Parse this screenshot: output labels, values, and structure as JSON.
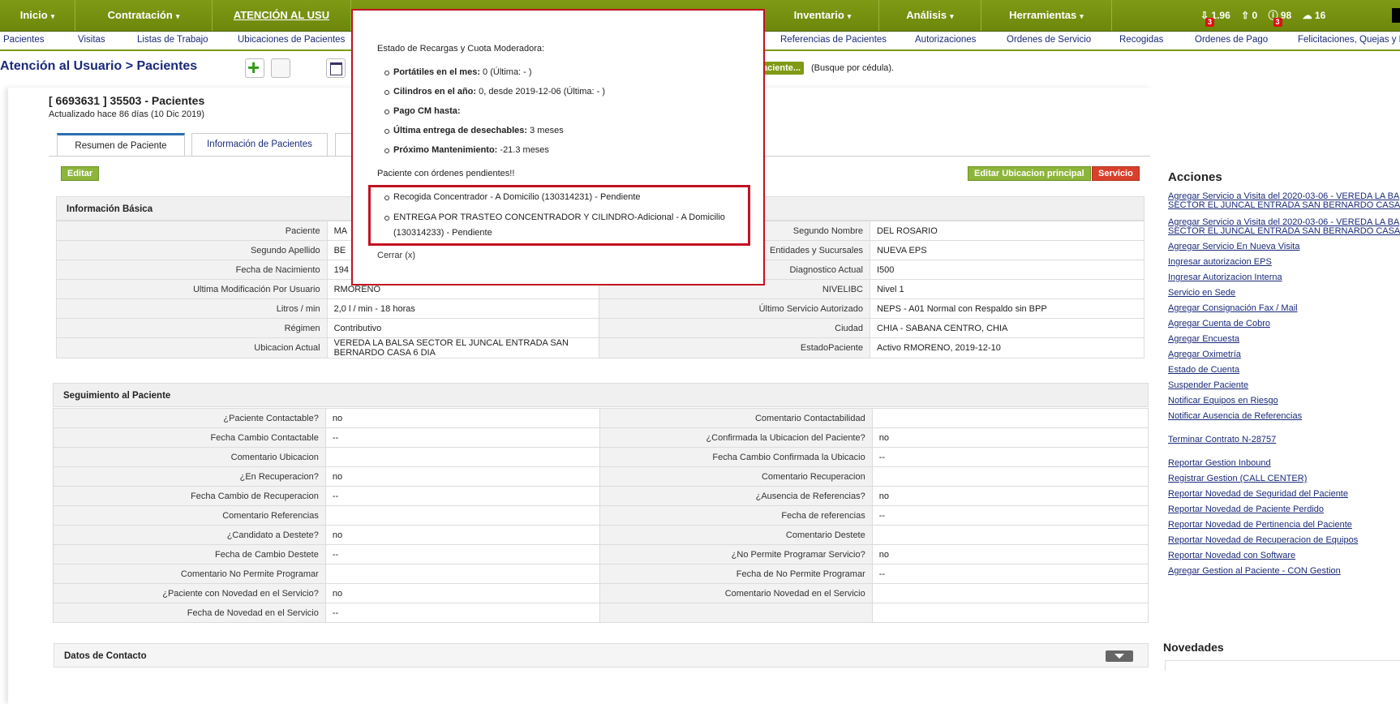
{
  "topnav": {
    "items": [
      {
        "label": "Inicio",
        "caret": "▾"
      },
      {
        "label": "Contratación",
        "caret": "▾"
      },
      {
        "label": "ATENCIÓN AL USU",
        "caret": ""
      },
      {
        "label": "Inventario",
        "caret": "▾"
      },
      {
        "label": "Análisis",
        "caret": "▾"
      },
      {
        "label": "Herramientas",
        "caret": "▾"
      }
    ],
    "badges": [
      {
        "icon": "download-icon",
        "count": "1.96",
        "alert": "3"
      },
      {
        "icon": "upload-icon",
        "count": "0",
        "alert": ""
      },
      {
        "icon": "alert-icon",
        "count": "98",
        "alert": "3"
      },
      {
        "icon": "chat-icon",
        "count": "16",
        "alert": ""
      }
    ]
  },
  "subnav": [
    "Pacientes",
    "Visitas",
    "Listas de Trabajo",
    "Ubicaciones de Pacientes",
    "Referencias de Pacientes",
    "Autorizaciones",
    "Ordenes de Servicio",
    "Recogidas",
    "Ordenes de Pago",
    "Felicitaciones, Quejas y R"
  ],
  "breadcrumb": {
    "section": "Atención al Usuario",
    "sep": " > ",
    "page": "Pacientes"
  },
  "search": {
    "button": "aciente...",
    "hint": "(Busque por cédula)."
  },
  "patient": {
    "title": "[ 6693631 ] 35503 - Pacientes",
    "updated": "Actualizado hace 86 días (10 Dic 2019)"
  },
  "tabs": [
    "Resumen de Paciente",
    "Información de Pacientes",
    ""
  ],
  "buttons": {
    "edit": "Editar",
    "edit_location": "Editar Ubicacion principal",
    "service": "Servicio"
  },
  "basic": {
    "header": "Información Básica",
    "rows": [
      [
        "Paciente",
        "MA",
        "Segundo Nombre",
        "DEL ROSARIO"
      ],
      [
        "Segundo Apellido",
        "BE",
        "Entidades y Sucursales",
        "NUEVA EPS"
      ],
      [
        "Fecha de Nacimiento",
        "194",
        "Diagnostico Actual",
        "I500"
      ],
      [
        "Ultima Modificación Por Usuario",
        "RMORENO",
        "NIVELIBC",
        "Nivel 1"
      ],
      [
        "Litros / min",
        "2,0 l / min - 18 horas",
        "Último Servicio Autorizado",
        "NEPS - A01 Normal con Respaldo sin BPP"
      ],
      [
        "Régimen",
        "Contributivo",
        "Ciudad",
        "CHIA - SABANA CENTRO, CHIA"
      ],
      [
        "Ubicacion Actual",
        "VEREDA LA BALSA SECTOR EL JUNCAL ENTRADA SAN BERNARDO CASA 6 DIA",
        "EstadoPaciente",
        "Activo RMORENO, 2019-12-10"
      ]
    ]
  },
  "seguimiento": {
    "header": "Seguimiento al Paciente",
    "rows": [
      [
        "¿Paciente Contactable?",
        "no",
        "Comentario Contactabilidad",
        ""
      ],
      [
        "Fecha Cambio Contactable",
        "--",
        "¿Confirmada la Ubicacion del Paciente?",
        "no"
      ],
      [
        "Comentario Ubicacion",
        "",
        "Fecha Cambio Confirmada la Ubicacio",
        "--"
      ],
      [
        "¿En Recuperacion?",
        "no",
        "Comentario Recuperacion",
        ""
      ],
      [
        "Fecha Cambio de Recuperacion",
        "--",
        "¿Ausencia de Referencias?",
        "no"
      ],
      [
        "Comentario Referencias",
        "",
        "Fecha de referencias",
        "--"
      ],
      [
        "¿Candidato a Destete?",
        "no",
        "Comentario Destete",
        ""
      ],
      [
        "Fecha de Cambio Destete",
        "--",
        "¿No Permite Programar Servicio?",
        "no"
      ],
      [
        "Comentario No Permite Programar",
        "",
        "Fecha de No Permite Programar",
        "--"
      ],
      [
        "¿Paciente con Novedad en el Servicio?",
        "no",
        "Comentario Novedad en el Servicio",
        ""
      ],
      [
        "Fecha de Novedad en el Servicio",
        "--",
        "",
        ""
      ]
    ]
  },
  "contacto": {
    "header": "Datos de Contacto"
  },
  "acciones": {
    "title": "Acciones",
    "links": [
      "Agregar Servicio a Visita del 2020-03-06 - VEREDA LA BA",
      "SECTOR EL JUNCAL ENTRADA SAN BERNARDO CASA",
      "Agregar Servicio a Visita del 2020-03-06 - VEREDA LA BA",
      "SECTOR EL JUNCAL ENTRADA SAN BERNARDO CASA",
      "Agregar Servicio En Nueva Visita",
      "Ingresar autorizacion EPS",
      "Ingresar Autorizacion Interna",
      "Servicio en Sede",
      "Agregar Consignación Fax / Mail",
      "Agregar Cuenta de Cobro",
      "Agregar Encuesta",
      "Agregar Oximetría",
      "Estado de Cuenta",
      "Suspender Paciente",
      "Notificar Equipos en Riesgo",
      "Notificar Ausencia de Referencias",
      "Terminar Contrato N-28757",
      "Reportar Gestion Inbound",
      "Registrar Gestion (CALL CENTER)",
      "Reportar Novedad de Seguridad del Paciente",
      "Reportar Novedad de Paciente Perdido",
      "Reportar Novedad de Pertinencia del Paciente",
      "Reportar Novedad de Recuperacion de Equipos",
      "Reportar Novedad con Software",
      "Agregar Gestion al Paciente - CON Gestion"
    ],
    "novedades": "Novedades"
  },
  "modal": {
    "title": "Estado de Recargas y Cuota Moderadora:",
    "items": [
      {
        "label": "Portátiles en el mes:",
        "value": " 0 (Última: - )"
      },
      {
        "label": "Cilindros en el año:",
        "value": " 0, desde 2019-12-06 (Última: - )"
      },
      {
        "label": "Pago CM hasta:",
        "value": ""
      },
      {
        "label": "Última entrega de desechables:",
        "value": " 3 meses"
      },
      {
        "label": "Próximo Mantenimiento:",
        "value": " -21.3 meses"
      }
    ],
    "pending_title": "Paciente con órdenes pendientes!!",
    "pending": [
      "Recogida Concentrador - A Domicilio (130314231) - Pendiente",
      "ENTREGA POR TRASTEO CONCENTRADOR Y CILINDRO-Adicional - A Domicilio",
      "(130314233) - Pendiente"
    ],
    "close": "Cerrar (x)"
  }
}
